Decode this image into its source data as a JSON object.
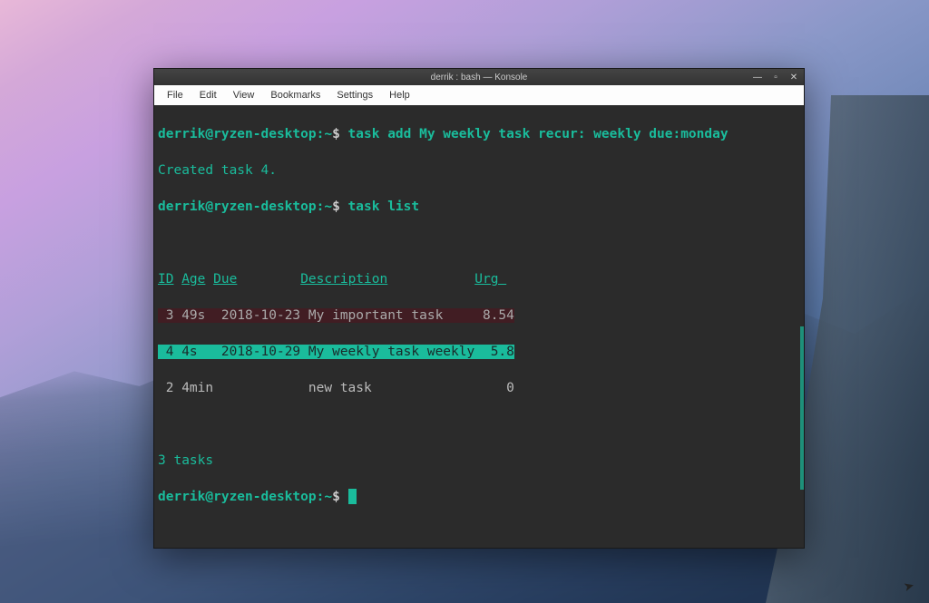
{
  "window": {
    "title": "derrik : bash — Konsole",
    "controls": {
      "minimize": "—",
      "maximize": "▫",
      "close": "✕"
    }
  },
  "menubar": {
    "items": [
      "File",
      "Edit",
      "View",
      "Bookmarks",
      "Settings",
      "Help"
    ]
  },
  "prompt": {
    "user_host": "derrik@ryzen-desktop",
    "separator": ":",
    "path": "~",
    "sigil": "$"
  },
  "session": {
    "cmd1": "task add My weekly task recur: weekly due:monday",
    "out1": "Created task 4.",
    "cmd2": "task list",
    "headers": {
      "id": "ID",
      "age": "Age",
      "due": "Due",
      "desc": "Description",
      "urg": "Urg "
    },
    "rows": [
      {
        "id": " 3",
        "age": "49s ",
        "due": "2018-10-23",
        "desc": "My important task    ",
        "urg": " 8.54"
      },
      {
        "id": " 4",
        "age": "4s  ",
        "due": "2018-10-29",
        "desc": "My weekly task weekly",
        "urg": "  5.8"
      },
      {
        "id": " 2",
        "age": "4min",
        "due": "          ",
        "desc": "new task             ",
        "urg": "    0"
      }
    ],
    "summary": "3 tasks"
  }
}
